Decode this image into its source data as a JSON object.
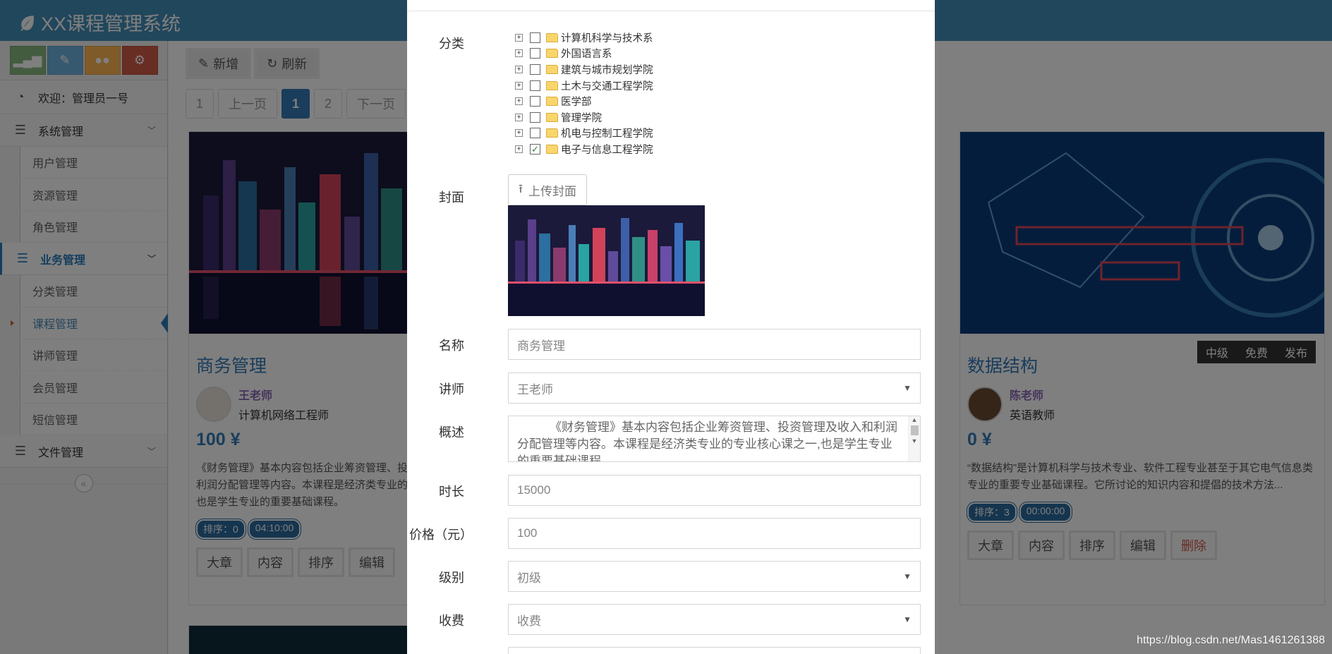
{
  "app": {
    "title": "XX课程管理系统"
  },
  "sidebar": {
    "shortcuts": [
      "chart-icon",
      "pencil-icon",
      "users-icon",
      "gears-icon"
    ],
    "welcome": "欢迎：管理员一号",
    "menus": [
      {
        "label": "系统管理",
        "items": [
          "用户管理",
          "资源管理",
          "角色管理"
        ]
      },
      {
        "label": "业务管理",
        "items": [
          "分类管理",
          "课程管理",
          "讲师管理",
          "会员管理",
          "短信管理"
        ]
      },
      {
        "label": "文件管理",
        "items": []
      }
    ],
    "collapse": "«"
  },
  "toolbar": {
    "add": "新增",
    "refresh": "刷新"
  },
  "pager": {
    "first": "1",
    "prev": "上一页",
    "current": "1",
    "next_page_num": "2",
    "next": "下一页"
  },
  "cards": [
    {
      "title": "商务管理",
      "teacher_name": "王老师",
      "teacher_title": "计算机网络工程师",
      "price": "100 ¥",
      "desc": "《财务管理》基本内容包括企业筹资管理、投资管理及收入和利润分配管理等内容。本课程是经济类专业的专业核心课之一,也是学生专业的重要基础课程。",
      "sort": "排序：0",
      "duration": "04:10:00",
      "actions": [
        "大章",
        "内容",
        "排序",
        "编辑"
      ]
    },
    {
      "title": "数据结构",
      "teacher_name": "陈老师",
      "teacher_title": "英语教师",
      "price": "0 ¥",
      "desc": "“数据结构”是计算机科学与技术专业、软件工程专业甚至于其它电气信息类专业的重要专业基础课程。它所讨论的知识内容和提倡的技术方法...",
      "sort": "排序：3",
      "duration": "00:00:00",
      "actions": [
        "大章",
        "内容",
        "排序",
        "编辑",
        "删除"
      ],
      "tags": [
        "中级",
        "免费",
        "发布"
      ]
    }
  ],
  "modal": {
    "category_label": "分类",
    "categories": [
      {
        "name": "计算机科学与技术系",
        "checked": false
      },
      {
        "name": "外国语言系",
        "checked": false
      },
      {
        "name": "建筑与城市规划学院",
        "checked": false
      },
      {
        "name": "土木与交通工程学院",
        "checked": false
      },
      {
        "name": "医学部",
        "checked": false
      },
      {
        "name": "管理学院",
        "checked": false
      },
      {
        "name": "机电与控制工程学院",
        "checked": false
      },
      {
        "name": "电子与信息工程学院",
        "checked": true
      }
    ],
    "cover_label": "封面",
    "upload_label": "上传封面",
    "name_label": "名称",
    "name_value": "商务管理",
    "teacher_label": "讲师",
    "teacher_value": "王老师",
    "summary_label": "概述",
    "summary_value": "《财务管理》基本内容包括企业筹资管理、投资管理及收入和利润分配管理等内容。本课程是经济类专业的专业核心课之一,也是学生专业的重要基础课程。",
    "duration_label": "时长",
    "duration_value": "15000",
    "price_label": "价格（元）",
    "price_value": "100",
    "level_label": "级别",
    "level_value": "初级",
    "charge_label": "收费",
    "charge_value": "收费"
  },
  "watermark": "https://blog.csdn.net/Mas1461261388"
}
